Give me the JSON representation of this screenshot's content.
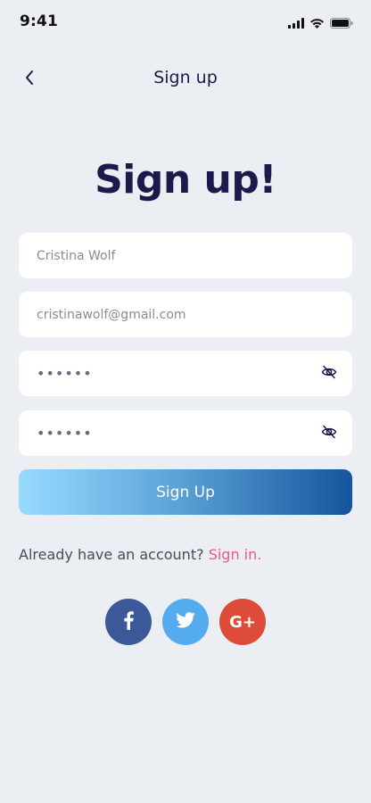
{
  "status_bar": {
    "time": "9:41"
  },
  "nav": {
    "title": "Sign up"
  },
  "headline": "Sign up!",
  "form": {
    "name_value": "Cristina Wolf",
    "email_value": "cristinawolf@gmail.com",
    "password_value": "••••••",
    "confirm_password_value": "••••••"
  },
  "signup_button_label": "Sign Up",
  "footer": {
    "prompt": "Already have an account?",
    "link": "Sign in."
  },
  "social": [
    {
      "icon": "facebook-icon",
      "color": "#3b5998"
    },
    {
      "icon": "twitter-icon",
      "color": "#54abee"
    },
    {
      "icon": "google-plus-icon",
      "color": "#dd4b39",
      "label": "G+"
    }
  ],
  "colors": {
    "background": "#ebeef3",
    "title": "#1b1b4b",
    "link": "#f0587f",
    "button_gradient_start": "#99daff",
    "button_gradient_end": "#14559c"
  }
}
